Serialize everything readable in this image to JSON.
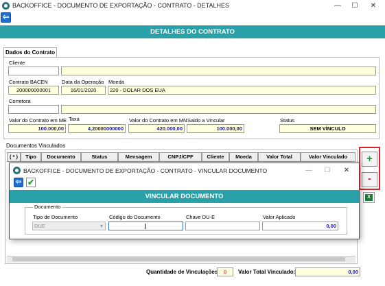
{
  "window": {
    "title": "BACKOFFICE - DOCUMENTO DE EXPORTAÇÃO - CONTRATO - DETALHES",
    "minimize": "—",
    "maximize": "☐",
    "close": "✕"
  },
  "toolbar": {
    "back_glyph": "⇦"
  },
  "header": {
    "title": "DETALHES DO CONTRATO"
  },
  "tabs": [
    {
      "label": "Dados do Contrato"
    }
  ],
  "contract": {
    "cliente_label": "Cliente",
    "cliente_code": "",
    "cliente_name": "",
    "contrato_bacen_label": "Contrato BACEN",
    "contrato_bacen_value": "200000000001",
    "data_operacao_label": "Data da Operação",
    "data_operacao_value": "16/01/2020",
    "moeda_label": "Moeda",
    "moeda_value": "220 - DOLAR DOS EUA",
    "corretora_label": "Corretora",
    "corretora_code": "",
    "corretora_name": "",
    "valor_me_label": "Valor do Contrato em ME",
    "valor_me_value": "100.000,00",
    "taxa_label": "Taxa",
    "taxa_value": "4,20000000000",
    "valor_mn_label": "Valor do Contrato em MN",
    "valor_mn_value": "420.000,00",
    "saldo_label": "Saldo a Vincular",
    "saldo_value": "100.000,00",
    "status_label": "Status",
    "status_value": "SEM VÍNCULO"
  },
  "documents": {
    "section_label": "Documentos Vinculados",
    "columns": [
      "( * )",
      "Tipo",
      "Documento",
      "Status",
      "Mensagem",
      "CNPJ/CPF",
      "Cliente",
      "Moeda",
      "Valor Total",
      "Valor Vinculado"
    ]
  },
  "side_buttons": {
    "add": "+",
    "remove": "-",
    "excel": "X"
  },
  "footer": {
    "qtd_label": "Quantidade de Vinculações:",
    "qtd_value": "0",
    "total_label": "Valor Total Vinculado:",
    "total_value": "0,00"
  },
  "modal": {
    "title": "BACKOFFICE - DOCUMENTO DE EXPORTAÇÃO - CONTRATO - VINCULAR DOCUMENTO",
    "minimize": "—",
    "maximize": "☐",
    "close": "✕",
    "back_glyph": "⇦",
    "confirm_glyph": "✔",
    "header": "VINCULAR DOCUMENTO",
    "group_label": "Documento",
    "tipo_label": "Tipo de Documento",
    "tipo_value": "DUE",
    "codigo_label": "Código do Documento",
    "codigo_value": "",
    "chave_label": "Chave DU-E",
    "chave_value": "",
    "valor_label": "Valor Aplicado",
    "valor_value": "0,00"
  },
  "colors": {
    "accent": "#2aa0a8",
    "highlight": "#e0202a",
    "field_yellow": "#ffffde",
    "value_blue": "#1a1aa8"
  }
}
